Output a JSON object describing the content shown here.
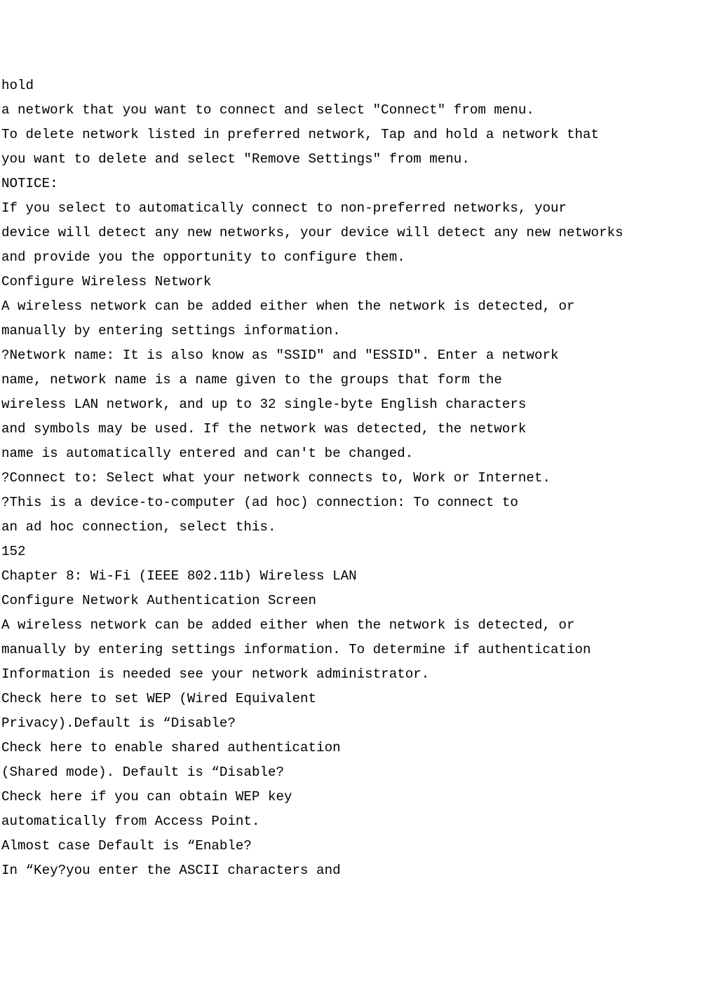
{
  "lines": [
    "hold",
    "a network that you want to connect and select \"Connect\" from menu.",
    "To delete network listed in preferred network, Tap and hold a network that",
    "you want to delete and select \"Remove Settings\" from menu.",
    "NOTICE:",
    "If you select to automatically connect to non-preferred networks, your",
    "device will detect any new networks, your device will detect any new networks",
    "and provide you the opportunity to configure them.",
    "Configure Wireless Network",
    "A wireless network can be added either when the network is detected, or",
    "manually by entering settings information.",
    "?Network name: It is also know as \"SSID\" and \"ESSID\". Enter a network",
    "name, network name is a name given to the groups that form the",
    "wireless LAN network, and up to 32 single-byte English characters",
    "and symbols may be used. If the network was detected, the network",
    "name is automatically entered and can't be changed.",
    "?Connect to: Select what your network connects to, Work or Internet.",
    "?This is a device-to-computer (ad hoc) connection: To connect to",
    "an ad hoc connection, select this.",
    "152",
    "Chapter 8: Wi-Fi (IEEE 802.11b) Wireless LAN",
    "Configure Network Authentication Screen",
    "A wireless network can be added either when the network is detected, or",
    "manually by entering settings information. To determine if authentication",
    "Information is needed see your network administrator.",
    "Check here to set WEP (Wired Equivalent",
    "Privacy).Default is “Disable?",
    "Check here to enable shared authentication",
    "(Shared mode). Default is “Disable?",
    "Check here if you can obtain WEP key",
    "automatically from Access Point.",
    "Almost case Default is “Enable?",
    "In “Key?you enter the ASCII characters and"
  ]
}
